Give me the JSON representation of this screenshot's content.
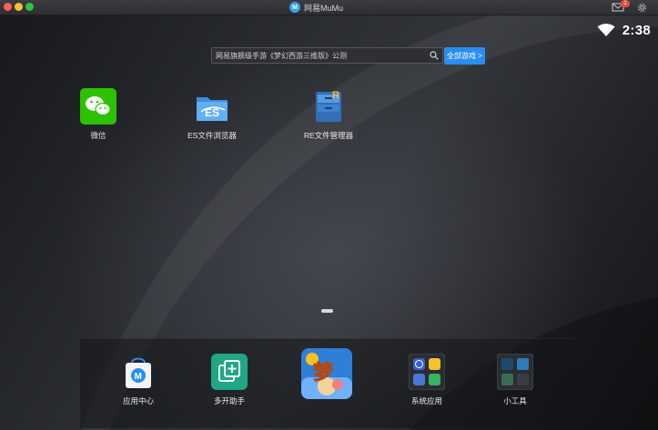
{
  "window": {
    "title": "网易MuMu",
    "logo_text": "M",
    "mail_badge": "1"
  },
  "status": {
    "time": "2:38"
  },
  "search": {
    "placeholder": "网易旗舰级手游《梦幻西游三维版》公测",
    "all_games_label": "全部游戏 >"
  },
  "desktop_apps": [
    {
      "label": "微信",
      "icon": "wechat-icon"
    },
    {
      "label": "ES文件浏览器",
      "icon": "es-file-explorer-icon"
    },
    {
      "label": "RE文件管理器",
      "icon": "re-file-manager-icon"
    }
  ],
  "dock": [
    {
      "label": "应用中心",
      "icon": "app-center-icon"
    },
    {
      "label": "多开助手",
      "icon": "multi-instance-icon"
    },
    {
      "label": "",
      "icon": "menghuan-xiyou-game-icon",
      "glyph": "梦"
    },
    {
      "label": "系统应用",
      "icon": "system-apps-folder-icon"
    },
    {
      "label": "小工具",
      "icon": "tools-folder-icon"
    }
  ],
  "colors": {
    "accent": "#2a8ef0",
    "wechat": "#2dc100",
    "mumu": "#3aa0ec",
    "badge": "#e84a4a"
  }
}
